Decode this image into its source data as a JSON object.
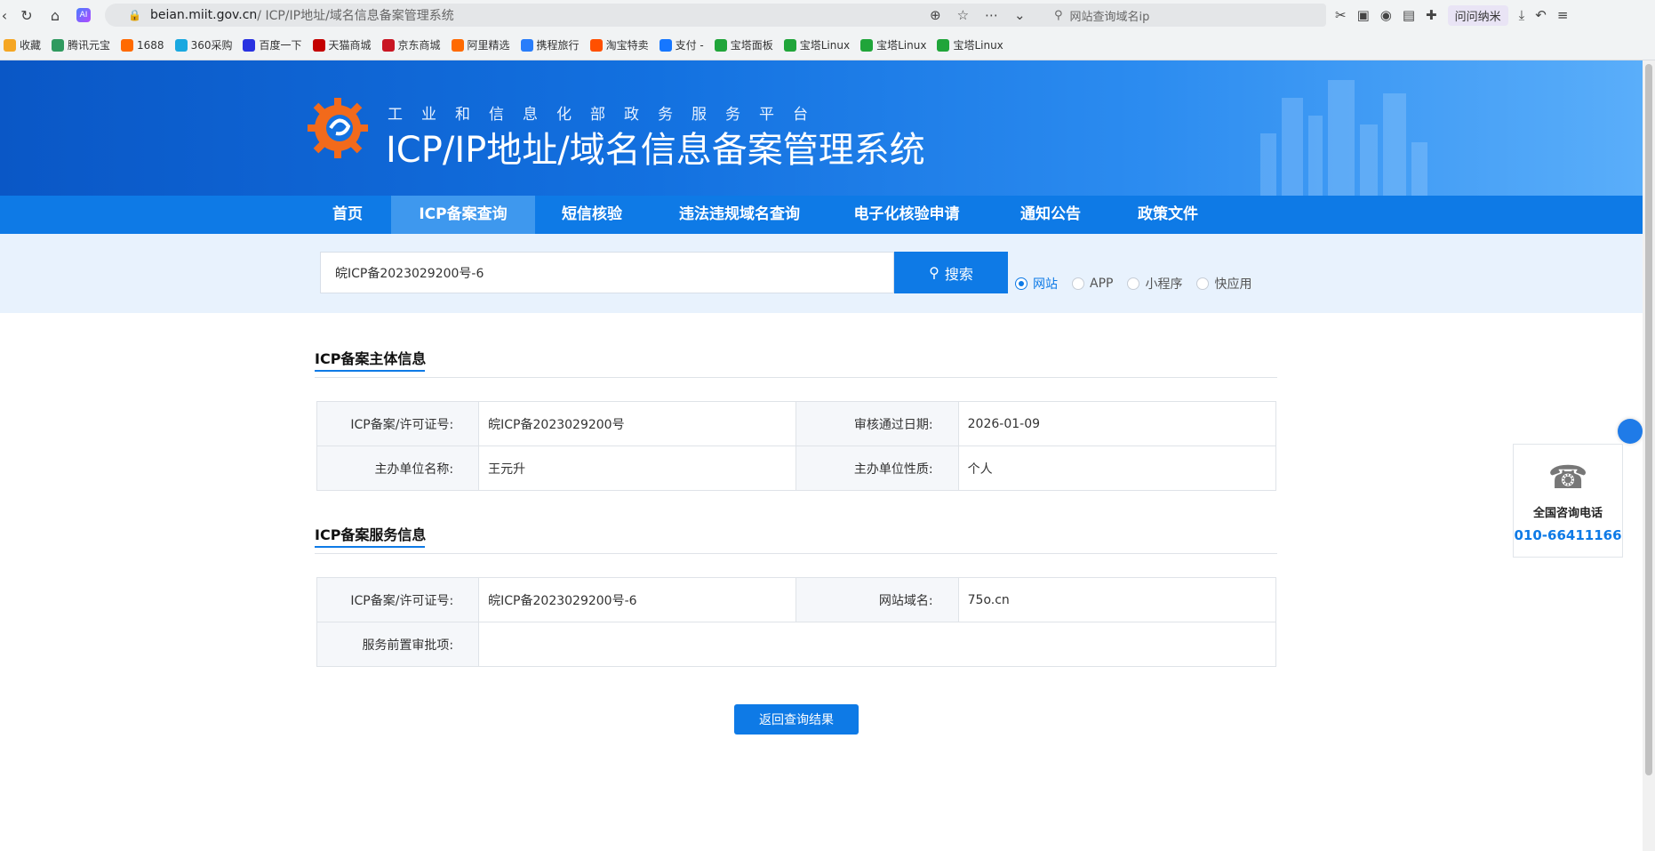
{
  "browser": {
    "url_host": "beian.miit.gov.cn",
    "url_path": " / ICP/IP地址/域名信息备案管理系统",
    "search_placeholder": "网站查询域名ip",
    "user_chip": "问问纳米"
  },
  "bookmarks": [
    {
      "label": "收藏",
      "color": "#f5a623"
    },
    {
      "label": "腾讯元宝",
      "color": "#2f9a5f"
    },
    {
      "label": "1688",
      "color": "#ff6a00"
    },
    {
      "label": "360采购",
      "color": "#19a8e0"
    },
    {
      "label": "百度一下",
      "color": "#2932e1"
    },
    {
      "label": "天猫商城",
      "color": "#c40000"
    },
    {
      "label": "京东商城",
      "color": "#c91623"
    },
    {
      "label": "阿里精选",
      "color": "#ff6a00"
    },
    {
      "label": "携程旅行",
      "color": "#287dfa"
    },
    {
      "label": "淘宝特卖",
      "color": "#ff5000"
    },
    {
      "label": "支付 -",
      "color": "#1677ff"
    },
    {
      "label": "宝塔面板",
      "color": "#20a53a"
    },
    {
      "label": "宝塔Linux",
      "color": "#20a53a"
    },
    {
      "label": "宝塔Linux",
      "color": "#20a53a"
    },
    {
      "label": "宝塔Linux",
      "color": "#20a53a"
    }
  ],
  "header": {
    "subtitle": "工业和信息化部政务服务平台",
    "title": "ICP/IP地址/域名信息备案管理系统"
  },
  "nav": [
    {
      "label": "首页"
    },
    {
      "label": "ICP备案查询"
    },
    {
      "label": "短信核验"
    },
    {
      "label": "违法违规域名查询"
    },
    {
      "label": "电子化核验申请"
    },
    {
      "label": "通知公告"
    },
    {
      "label": "政策文件"
    }
  ],
  "search": {
    "value": "皖ICP备2023029200号-6",
    "button_label": "搜索",
    "options": [
      "网站",
      "APP",
      "小程序",
      "快应用"
    ]
  },
  "subject_info": {
    "title": "ICP备案主体信息",
    "rows": [
      {
        "k1": "ICP备案/许可证号:",
        "v1": "皖ICP备2023029200号",
        "k2": "审核通过日期:",
        "v2": "2026-01-09"
      },
      {
        "k1": "主办单位名称:",
        "v1": "王元升",
        "k2": "主办单位性质:",
        "v2": "个人"
      }
    ]
  },
  "service_info": {
    "title": "ICP备案服务信息",
    "row1": {
      "k1": "ICP备案/许可证号:",
      "v1": "皖ICP备2023029200号-6",
      "k2": "网站域名:",
      "v2": "75o.cn"
    },
    "row2": {
      "k1": "服务前置审批项:",
      "v1": ""
    }
  },
  "back_button": "返回查询结果",
  "consult": {
    "label": "全国咨询电话",
    "phone": "010-66411166"
  },
  "colors": {
    "brand_blue": "#0e7ae6",
    "nav_active": "#3e98ee"
  }
}
